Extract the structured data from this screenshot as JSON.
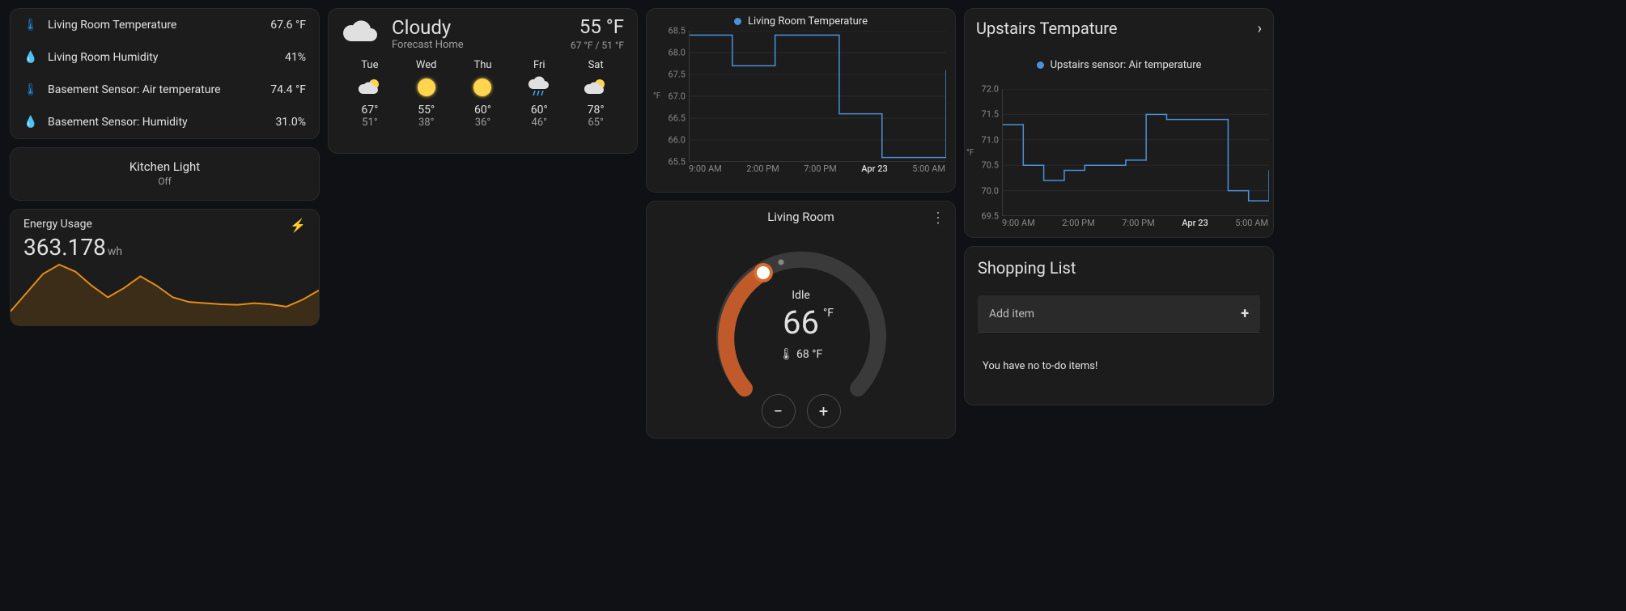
{
  "sensors": [
    {
      "icon": "temp",
      "name": "Living Room Temperature",
      "value": "67.6 °F"
    },
    {
      "icon": "hum",
      "name": "Living Room Humidity",
      "value": "41%"
    },
    {
      "icon": "temp",
      "name": "Basement Sensor: Air temperature",
      "value": "74.4 °F"
    },
    {
      "icon": "hum",
      "name": "Basement Sensor: Humidity",
      "value": "31.0%"
    }
  ],
  "kitchen": {
    "title": "Kitchen Light",
    "state": "Off"
  },
  "energy": {
    "title": "Energy Usage",
    "value": "363.178",
    "unit": "wh"
  },
  "weather": {
    "condition": "Cloudy",
    "location": "Forecast Home",
    "current": "55 °F",
    "hilo": "67 °F / 51 °F",
    "days": [
      {
        "name": "Tue",
        "icon": "partly",
        "hi": "67°",
        "lo": "51°"
      },
      {
        "name": "Wed",
        "icon": "sunny",
        "hi": "55°",
        "lo": "38°"
      },
      {
        "name": "Thu",
        "icon": "sunny",
        "hi": "60°",
        "lo": "36°"
      },
      {
        "name": "Fri",
        "icon": "rain",
        "hi": "60°",
        "lo": "46°"
      },
      {
        "name": "Sat",
        "icon": "partly",
        "hi": "78°",
        "lo": "65°"
      }
    ]
  },
  "thermostat": {
    "name": "Living Room",
    "state": "Idle",
    "current": "66",
    "current_unit": "°F",
    "target_prefix": "🌡",
    "target": "68 °F"
  },
  "upstairs": {
    "title": "Upstairs Tempature",
    "legend": "Upstairs sensor: Air temperature"
  },
  "shopping": {
    "title": "Shopping List",
    "add": "Add item",
    "empty": "You have no to-do items!"
  },
  "chart_data": [
    {
      "type": "line",
      "title": "Living Room Temperature",
      "ylabel": "°F",
      "ylim": [
        65.5,
        68.5
      ],
      "yticks": [
        65.5,
        66.0,
        66.5,
        67.0,
        67.5,
        68.0,
        68.5
      ],
      "xticks": [
        "9:00 AM",
        "2:00 PM",
        "7:00 PM",
        "Apr 23",
        "5:00 AM"
      ],
      "series": [
        {
          "name": "Living Room Temperature",
          "x": [
            "9:00 AM",
            "11:00 AM",
            "1:00 PM",
            "3:00 PM",
            "5:00 PM",
            "7:00 PM",
            "9:00 PM",
            "11:00 PM",
            "Apr 23",
            "3:00 AM",
            "5:00 AM",
            "7:00 AM",
            "8:00 AM"
          ],
          "y": [
            68.4,
            68.4,
            67.7,
            67.7,
            68.4,
            68.4,
            68.4,
            66.6,
            66.6,
            65.6,
            65.6,
            65.6,
            67.6
          ]
        }
      ]
    },
    {
      "type": "line",
      "title": "Upstairs sensor: Air temperature",
      "ylabel": "°F",
      "ylim": [
        69.5,
        72.0
      ],
      "yticks": [
        69.5,
        70.0,
        70.5,
        71.0,
        71.5,
        72.0
      ],
      "xticks": [
        "9:00 AM",
        "2:00 PM",
        "7:00 PM",
        "Apr 23",
        "5:00 AM"
      ],
      "series": [
        {
          "name": "Upstairs sensor: Air temperature",
          "x": [
            "9:00 AM",
            "10:00 AM",
            "11:00 AM",
            "1:00 PM",
            "2:00 PM",
            "3:00 PM",
            "5:00 PM",
            "6:00 PM",
            "8:00 PM",
            "Apr 23",
            "3:00 AM",
            "5:00 AM",
            "7:00 AM",
            "8:00 AM"
          ],
          "y": [
            71.3,
            70.5,
            70.2,
            70.4,
            70.5,
            70.5,
            70.6,
            71.5,
            71.4,
            71.4,
            71.4,
            70.0,
            69.8,
            70.4
          ]
        }
      ]
    },
    {
      "type": "area",
      "title": "Energy Usage",
      "ylabel": "wh",
      "series": [
        {
          "name": "Energy Usage",
          "x": [
            0,
            1,
            2,
            3,
            4,
            5,
            6,
            7,
            8,
            9,
            10,
            11,
            12,
            13,
            14,
            15,
            16,
            17,
            18,
            19
          ],
          "y": [
            60,
            140,
            220,
            260,
            230,
            170,
            120,
            160,
            210,
            170,
            120,
            100,
            95,
            90,
            88,
            95,
            90,
            80,
            110,
            150
          ]
        }
      ]
    }
  ]
}
